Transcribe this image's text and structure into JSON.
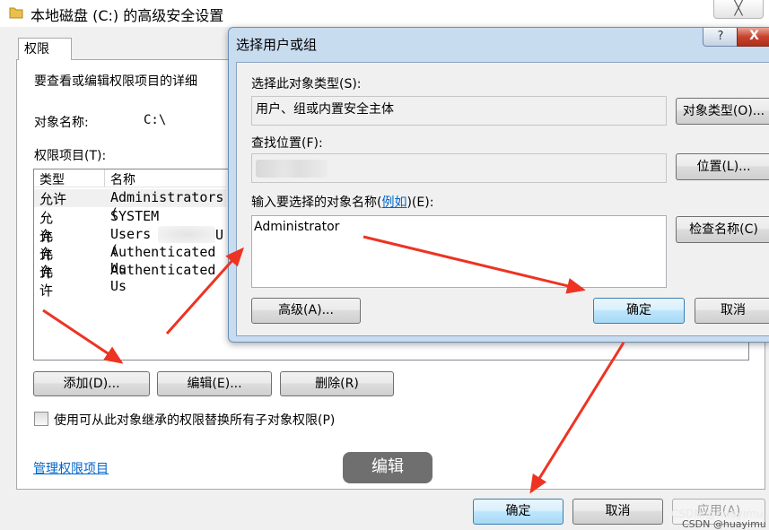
{
  "bg_window": {
    "title": "本地磁盘 (C:) 的高级安全设置",
    "close_label": "╳",
    "tab_label": "权限",
    "intro_text": "要查看或编辑权限项目的详细",
    "object_name_label": "对象名称:",
    "object_name_value": "C:\\",
    "entries_label": "权限项目(T):",
    "columns": [
      "类型",
      "名称"
    ],
    "rows": [
      {
        "type": "允许",
        "name": "Administrators ("
      },
      {
        "type": "允许",
        "name": "SYSTEM"
      },
      {
        "type": "允许",
        "name": "Users ("
      },
      {
        "type": "允许",
        "name": "Authenticated Us"
      },
      {
        "type": "允许",
        "name": "Authenticated Us"
      }
    ],
    "users_suffix": "U",
    "add_button": "添加(D)...",
    "edit_button": "编辑(E)...",
    "remove_button": "删除(R)",
    "replace_checkbox_label": "使用可从此对象继承的权限替换所有子对象权限(P)",
    "manage_link": "管理权限项目",
    "ok_button": "确定",
    "cancel_button": "取消",
    "apply_button": "应用(A)"
  },
  "overlay": {
    "edit_badge": "编辑",
    "watermark_1": "CSDN @huayimu",
    "watermark_2": "CSDN @huayimu"
  },
  "dialog": {
    "title": "选择用户或组",
    "help_label": "?",
    "close_label": "X",
    "object_type_label": "选择此对象类型(S):",
    "object_type_value": "用户、组或内置安全主体",
    "object_types_button": "对象类型(O)...",
    "location_label": "查找位置(F):",
    "location_button": "位置(L)...",
    "names_label_prefix": "输入要选择的对象名称(",
    "names_label_link": "例如",
    "names_label_suffix": ")(E):",
    "names_value": "Administrator",
    "check_names_button": "检查名称(C)",
    "advanced_button": "高级(A)...",
    "ok_button": "确定",
    "cancel_button": "取消"
  },
  "colors": {
    "arrow": "#ee3322",
    "link": "#0066cc",
    "badge": "#6f6f6f"
  }
}
